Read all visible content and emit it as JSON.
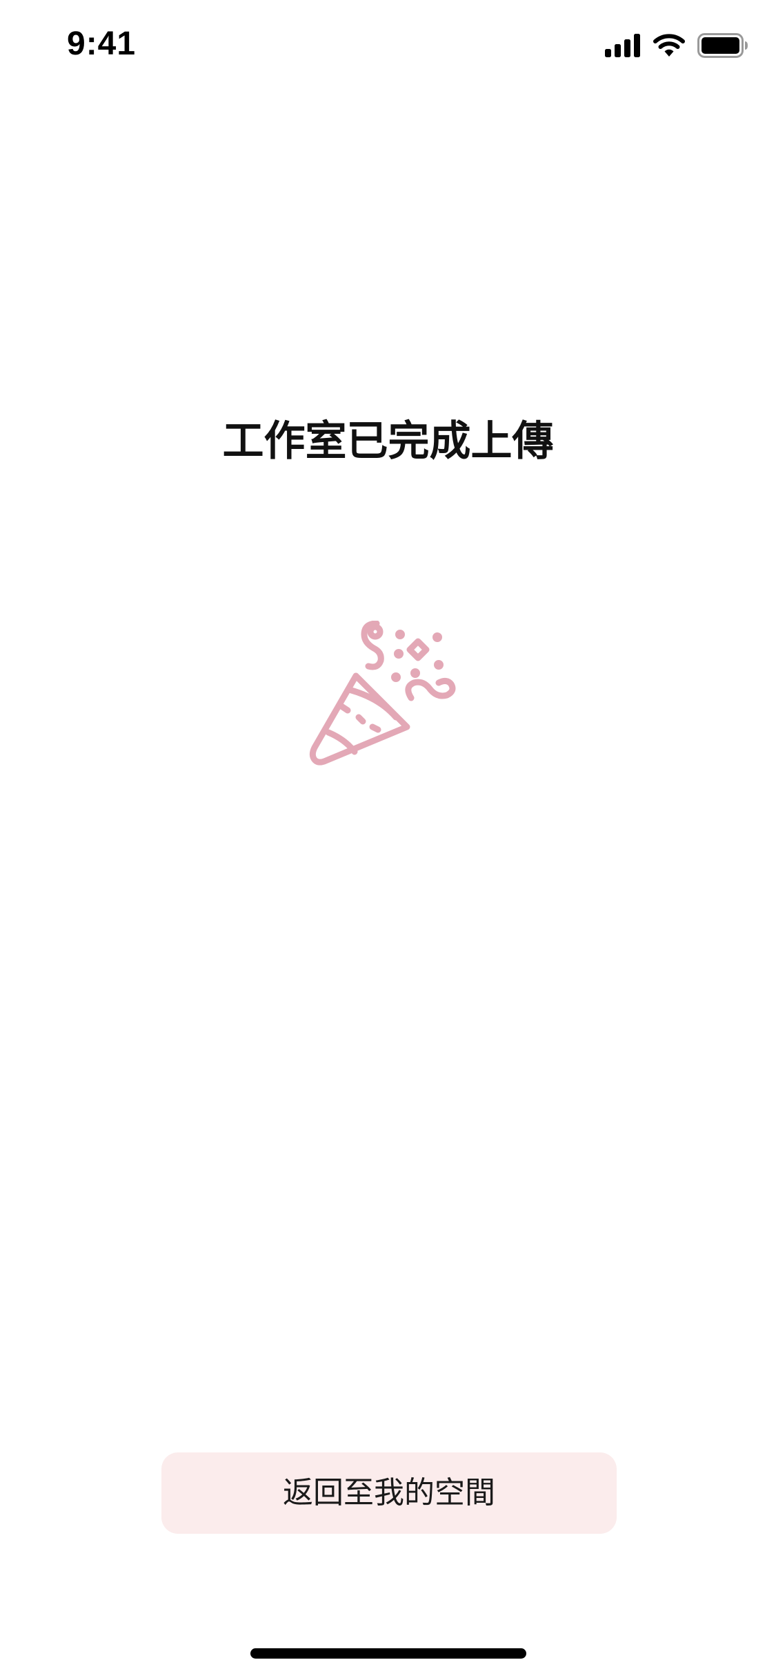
{
  "status_bar": {
    "time": "9:41",
    "icons": [
      "cellular-signal-icon",
      "wifi-icon",
      "battery-icon"
    ]
  },
  "main": {
    "title": "工作室已完成上傳",
    "illustration_icon": "party-popper-icon"
  },
  "footer": {
    "back_button_label": "返回至我的空間"
  },
  "colors": {
    "accent_pink": "#e3a8b6",
    "button_background": "#fbecec",
    "text_primary": "#111111"
  }
}
